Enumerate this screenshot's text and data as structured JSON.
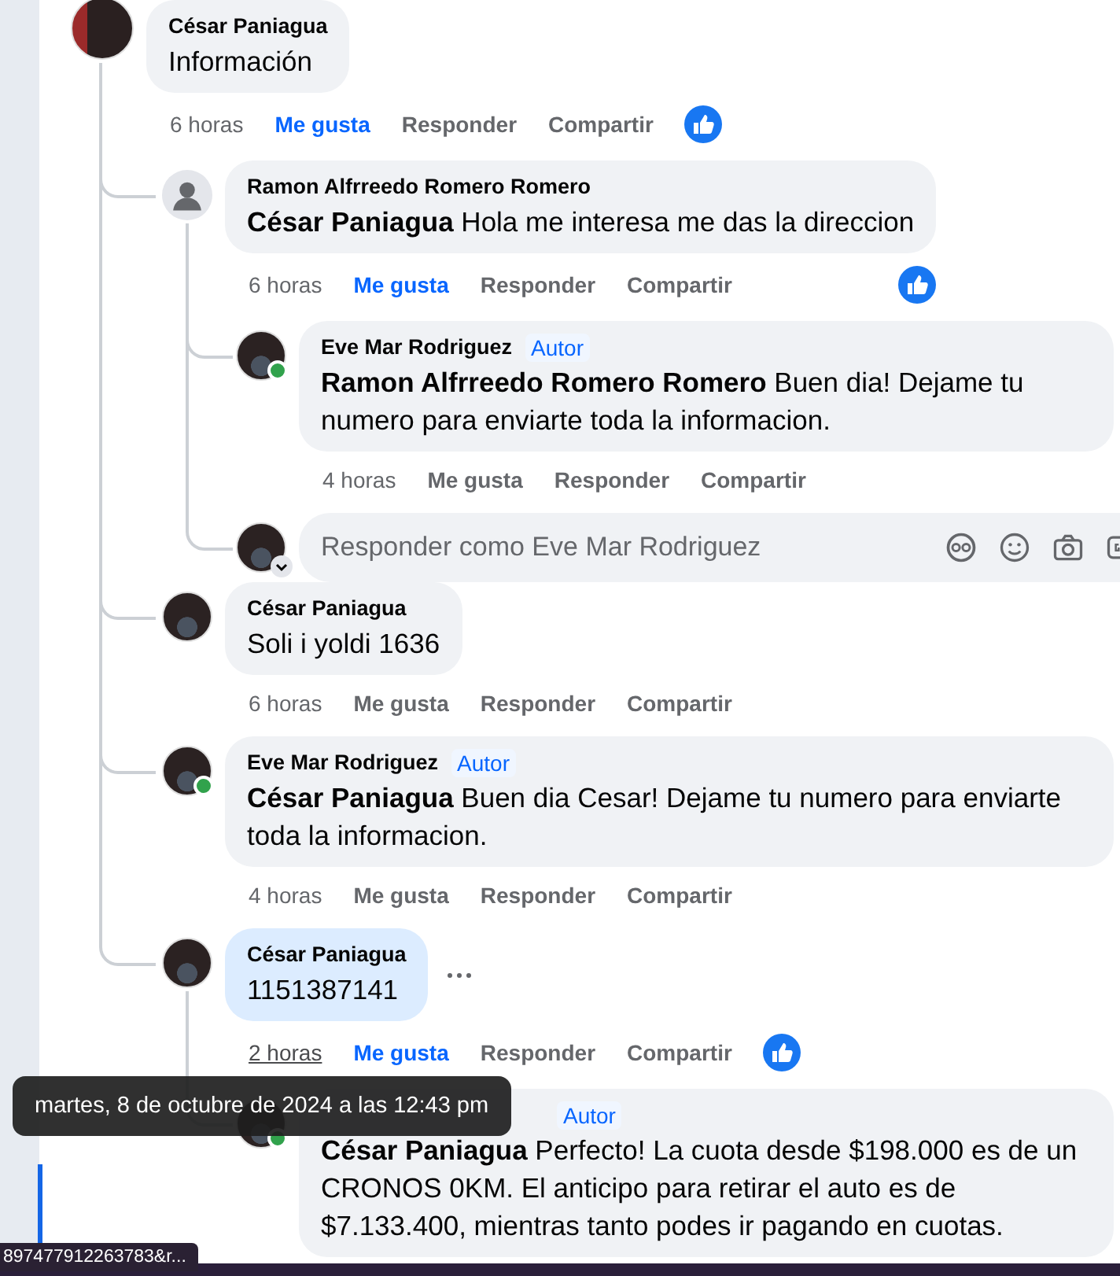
{
  "tooltip": "martes, 8 de octubre de 2024 a las 12:43 pm",
  "status_url": "897477912263783&r...",
  "comments": [
    {
      "author": "César Paniagua",
      "avatar": {
        "kind": "photo"
      },
      "text": "Información",
      "time": "6 horas",
      "like_label": "Me gusta",
      "liked": true,
      "reply_label": "Responder",
      "share_label": "Compartir",
      "reaction": true,
      "replies": [
        {
          "author": "Ramon Alfrreedo Romero Romero",
          "avatar": {
            "kind": "default"
          },
          "mention": "César Paniagua",
          "text": "Hola me interesa me das la direccion",
          "time": "6 horas",
          "like_label": "Me gusta",
          "liked": true,
          "reply_label": "Responder",
          "share_label": "Compartir",
          "reaction": true,
          "replies": [
            {
              "author": "Eve Mar Rodriguez",
              "badge": "Autor",
              "avatar": {
                "kind": "photo"
              },
              "online": true,
              "mention": "Ramon Alfrreedo Romero Romero",
              "text": "Buen dia! Dejame tu numero para enviarte toda la informacion.",
              "time": "4 horas",
              "like_label": "Me gusta",
              "liked": false,
              "reply_label": "Responder",
              "share_label": "Compartir"
            }
          ],
          "reply_box": {
            "placeholder": "Responder como Eve Mar Rodriguez"
          }
        },
        {
          "author": "César Paniagua",
          "avatar": {
            "kind": "photo"
          },
          "text": "Soli i yoldi 1636",
          "time": "6 horas",
          "like_label": "Me gusta",
          "liked": false,
          "reply_label": "Responder",
          "share_label": "Compartir"
        },
        {
          "author": "Eve Mar Rodriguez",
          "badge": "Autor",
          "avatar": {
            "kind": "photo"
          },
          "online": true,
          "mention": "César Paniagua",
          "text": "Buen dia Cesar! Dejame tu numero para enviarte toda la informacion.",
          "time": "4 horas",
          "like_label": "Me gusta",
          "liked": false,
          "reply_label": "Responder",
          "share_label": "Compartir"
        },
        {
          "author": "César Paniagua",
          "avatar": {
            "kind": "photo"
          },
          "text": "1151387141",
          "time": "2 horas",
          "time_hovered": true,
          "like_label": "Me gusta",
          "liked": true,
          "reply_label": "Responder",
          "share_label": "Compartir",
          "reaction": true,
          "highlighted": true,
          "menu_button": true,
          "replies": [
            {
              "badge": "Autor",
              "avatar": {
                "kind": "photo"
              },
              "online": true,
              "mention": "César Paniagua",
              "text": "Perfecto! La cuota desde $198.000 es de un CRONOS 0KM. El anticipo para retirar el auto es de $7.133.400, mientras tanto podes ir pagando en cuotas."
            }
          ]
        }
      ]
    }
  ]
}
